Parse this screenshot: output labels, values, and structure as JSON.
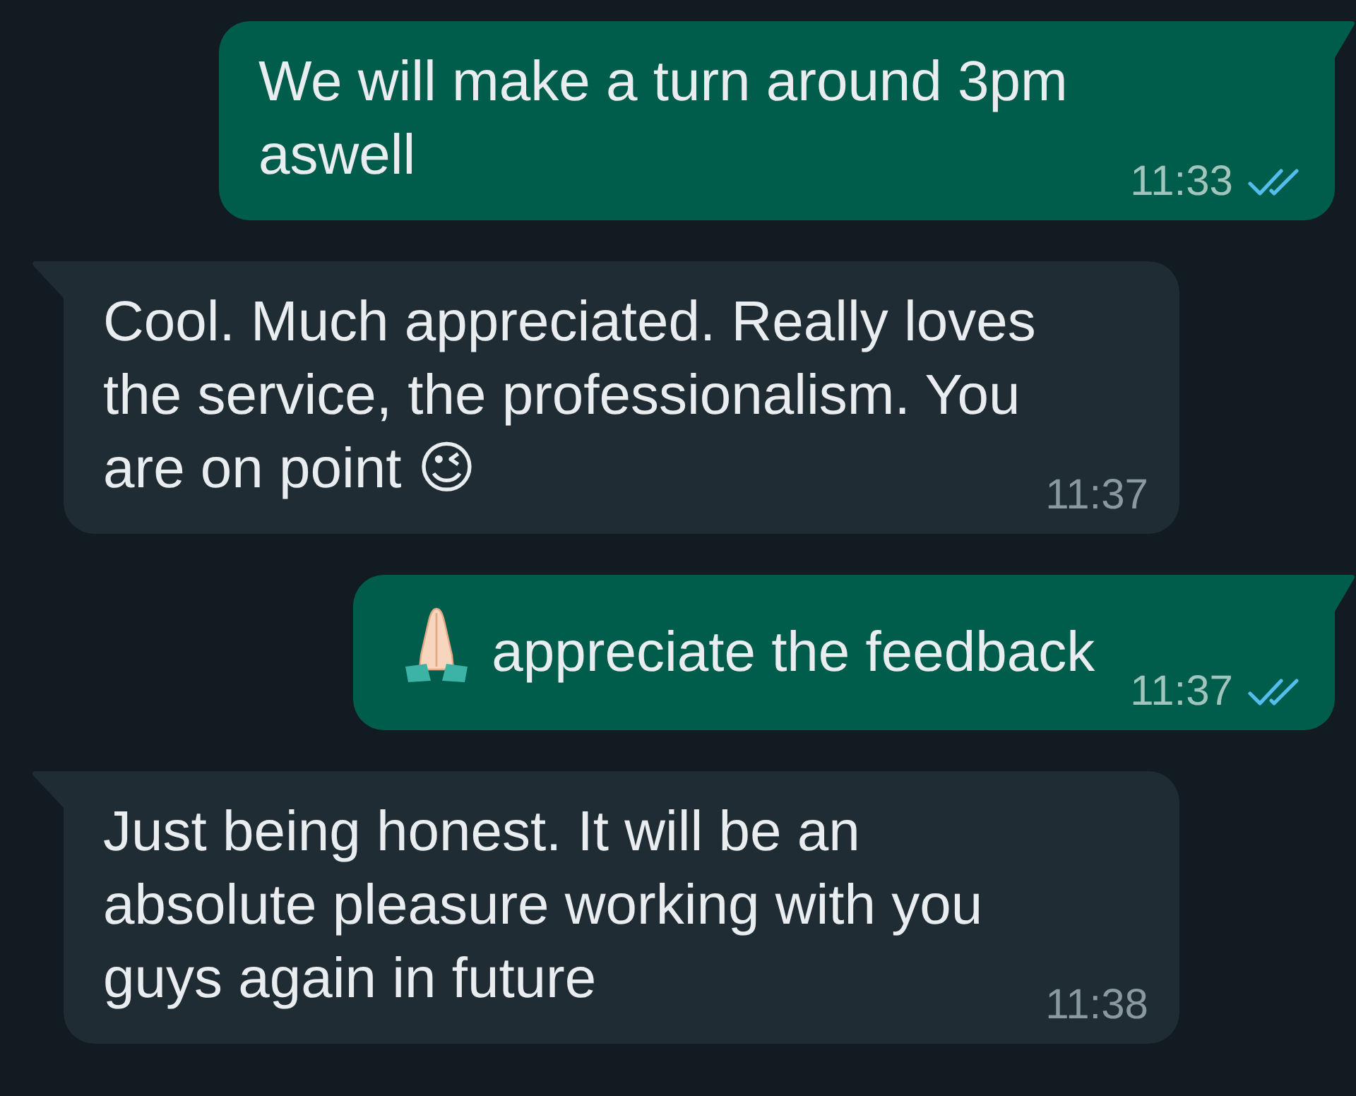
{
  "messages": [
    {
      "kind": "outgoing",
      "text": "We will make a turn around 3pm aswell",
      "time": "11:33",
      "read": true
    },
    {
      "kind": "incoming",
      "text": "Cool. Much appreciated. Really loves the service, the professionalism. You are on point 😉",
      "time": "11:37"
    },
    {
      "kind": "outgoing",
      "emoji_before": true,
      "text": "appreciate the feedback",
      "time": "11:37",
      "read": true
    },
    {
      "kind": "incoming",
      "text": "Just being honest. It will be an absolute pleasure working with you guys again in future",
      "time": "11:38"
    }
  ]
}
